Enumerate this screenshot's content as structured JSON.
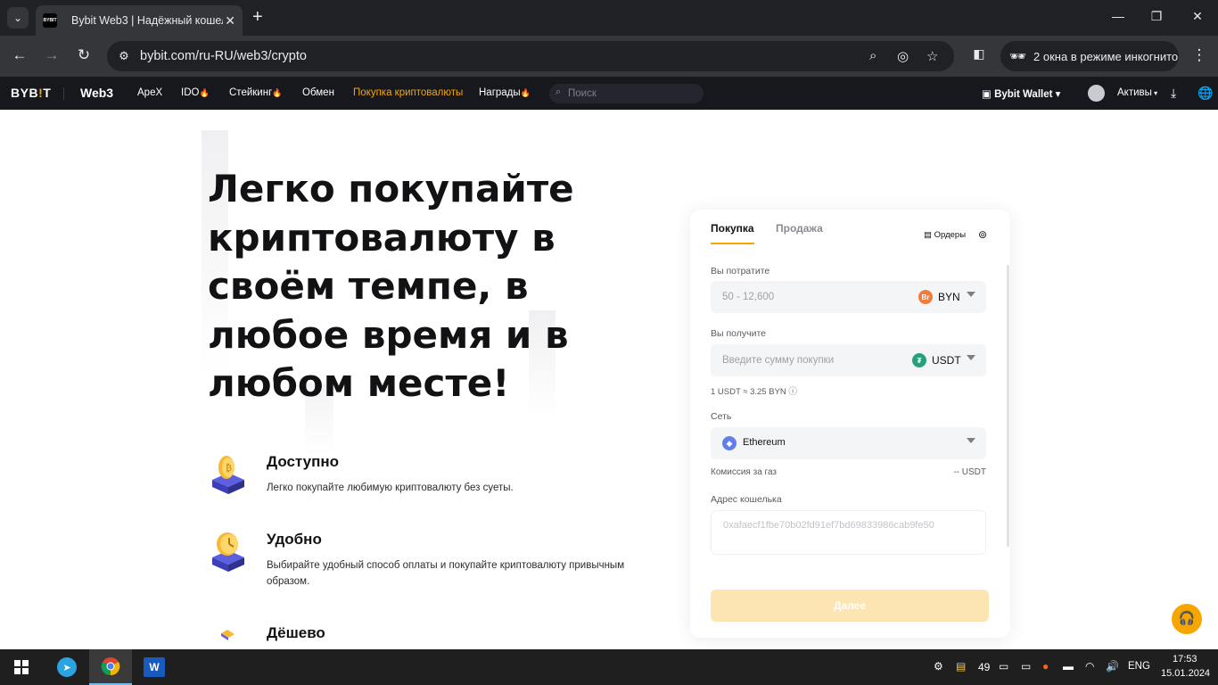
{
  "browser": {
    "tab_title": "Bybit Web3 | Надёжный кошелёк",
    "favicon_text": "BYBIT",
    "url": "bybit.com/ru-RU/web3/crypto",
    "incognito_label": "2 окна в режиме инкогнито"
  },
  "nav": {
    "logo": "BYB",
    "logo_bar": "!",
    "logo_tail": "T",
    "web3": "Web3",
    "links": [
      "ApeX",
      "IDO",
      "Стейкинг",
      "Обмен",
      "Покупка криптовалюты",
      "Награды"
    ],
    "search_placeholder": "Поиск",
    "wallet": "Bybit Wallet",
    "assets": "Активы"
  },
  "hero": {
    "title": "Легко покупайте криптовалюту в своём темпе, в любое время и в любом месте!"
  },
  "features": [
    {
      "title": "Доступно",
      "desc": "Легко покупайте любимую криптовалюту без суеты."
    },
    {
      "title": "Удобно",
      "desc": "Выбирайте удобный способ оплаты и покупайте криптовалюту привычным образом."
    },
    {
      "title": "Дёшево",
      "desc": ""
    }
  ],
  "widget": {
    "tab_buy": "Покупка",
    "tab_sell": "Продажа",
    "orders": "Ордеры",
    "spend_label": "Вы потратите",
    "spend_placeholder": "50 - 12,600",
    "spend_currency": "BYN",
    "spend_coin_glyph": "Br",
    "receive_label": "Вы получите",
    "receive_placeholder": "Введите сумму покупки",
    "receive_currency": "USDT",
    "receive_coin_glyph": "₮",
    "rate": "1 USDT ≈ 3.25 BYN",
    "network_label": "Сеть",
    "network": "Ethereum",
    "gas_label": "Комиссия за газ",
    "gas_value": "-- USDT",
    "address_label": "Адрес кошелька",
    "address": "0xafaecf1fbe70b02fd91ef7bd69833986cab9fe50",
    "next_button": "Далее"
  },
  "taskbar": {
    "tray_count": "49",
    "language": "ENG",
    "time": "17:53",
    "date": "15.01.2024"
  },
  "colors": {
    "accent": "#f7a600",
    "nav_bg": "#17181e",
    "next_disabled": "#fde5b3"
  }
}
